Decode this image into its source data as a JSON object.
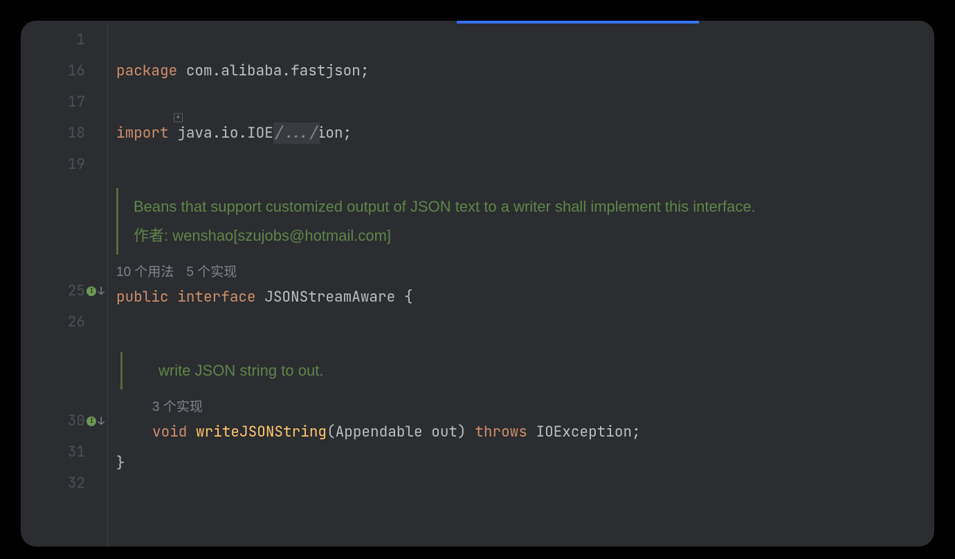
{
  "gutter": {
    "lines": [
      "1",
      "16",
      "17",
      "18",
      "19",
      "",
      "",
      "",
      "25",
      "26",
      "",
      "",
      "",
      "30",
      "31",
      "32"
    ],
    "impl_icon": "I"
  },
  "code": {
    "folded": "/.../",
    "kw_package": "package",
    "pkg_name": "com.alibaba.fastjson",
    "semi": ";",
    "kw_import": "import",
    "import_name": "java.io.IOException",
    "doc1_line1": "Beans that support customized output of JSON text to a writer shall implement this interface.",
    "doc1_line2": "作者: wenshao[szujobs@hotmail.com]",
    "hint1_usages": "10 个用法",
    "hint1_impls": "5 个实现",
    "kw_public": "public",
    "kw_interface": "interface",
    "iface_name": "JSONStreamAware",
    "brace_open": "{",
    "doc2_line1": "write JSON string to out.",
    "hint2_impls": "3 个实现",
    "kw_void": "void",
    "method_name": "writeJSONString",
    "param_type": "Appendable",
    "param_name": "out",
    "kw_throws": "throws",
    "throws_type": "IOException",
    "brace_close": "}"
  }
}
